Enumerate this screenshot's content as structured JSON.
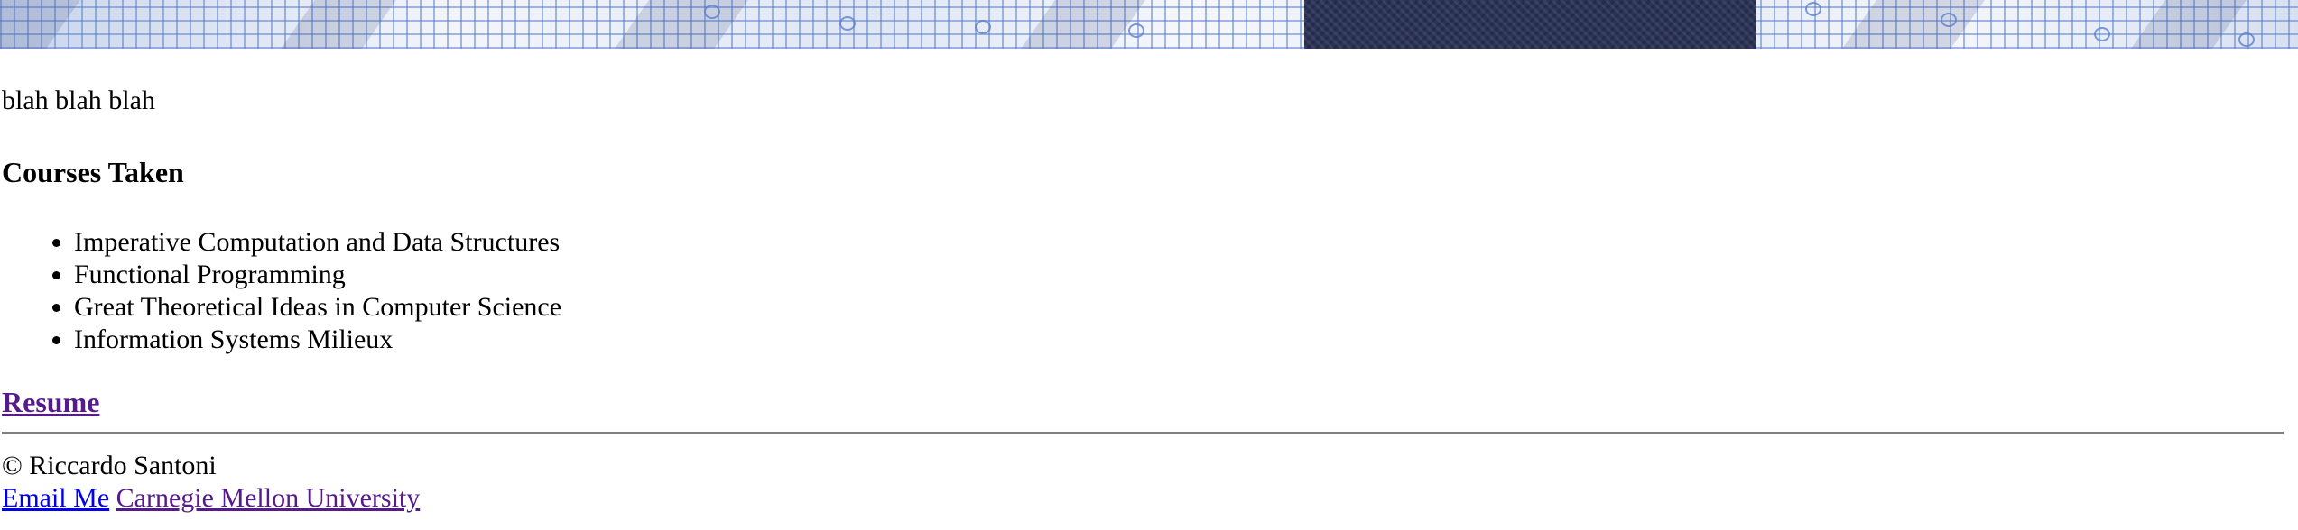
{
  "banner": {
    "image_description": "blue checkered shirt with navy tie"
  },
  "intro_text": "blah blah blah",
  "courses": {
    "heading": "Courses Taken",
    "items": [
      "Imperative Computation and Data Structures",
      "Functional Programming",
      "Great Theoretical Ideas in Computer Science",
      "Information Systems Milieux"
    ]
  },
  "resume_link": "Resume",
  "footer": {
    "copyright": "© Riccardo Santoni",
    "email_link": "Email Me",
    "university_link": "Carnegie Mellon University"
  },
  "colors": {
    "visited_link": "#551a8b",
    "unvisited_link": "#0000ee",
    "rule": "#808080",
    "tie": "#2b3458",
    "shirt_grid": "#5c80cd"
  }
}
